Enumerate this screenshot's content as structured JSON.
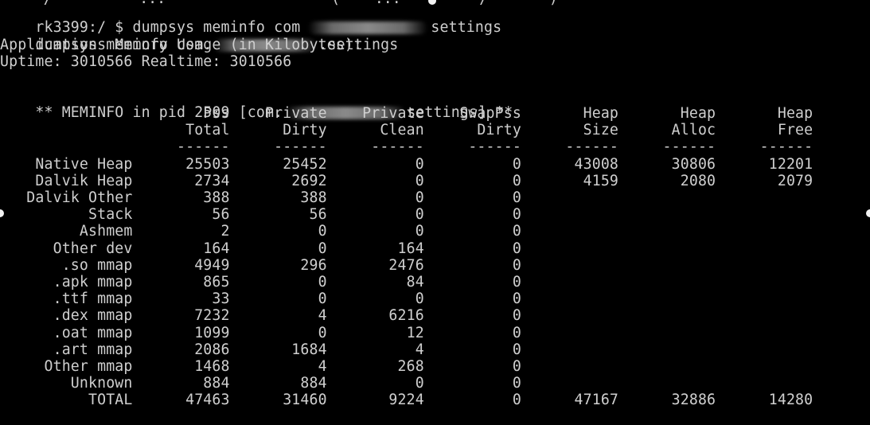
{
  "terminal": {
    "cut_top_line": "     /          ...                   (    ...         /       )",
    "prompt_prefix": "rk3399:/ $ dumpsys meminfo com",
    "prompt_suffix": "settings",
    "echo_prefix": "dumpsys meminfo com.",
    "echo_suffix": ".settings",
    "heading": "Applications Memory Usage (in Kilobytes):",
    "uptime_line": "Uptime: 3010566 Realtime: 3010566",
    "meminfo_prefix": "** MEMINFO in pid 2509 [com.",
    "meminfo_suffix": "settings] **"
  },
  "table": {
    "header_row1": [
      "Pss",
      "Private",
      "Private",
      "SwapPss",
      "Heap",
      "Heap",
      "Heap"
    ],
    "header_row2": [
      "Total",
      "Dirty",
      "Clean",
      "Dirty",
      "Size",
      "Alloc",
      "Free"
    ],
    "rows": [
      {
        "name": "Native Heap",
        "values": [
          "25503",
          "25452",
          "0",
          "0",
          "43008",
          "30806",
          "12201"
        ]
      },
      {
        "name": "Dalvik Heap",
        "values": [
          "2734",
          "2692",
          "0",
          "0",
          "4159",
          "2080",
          "2079"
        ]
      },
      {
        "name": "Dalvik Other",
        "values": [
          "388",
          "388",
          "0",
          "0",
          "",
          "",
          ""
        ]
      },
      {
        "name": "Stack",
        "values": [
          "56",
          "56",
          "0",
          "0",
          "",
          "",
          ""
        ]
      },
      {
        "name": "Ashmem",
        "values": [
          "2",
          "0",
          "0",
          "0",
          "",
          "",
          ""
        ]
      },
      {
        "name": "Other dev",
        "values": [
          "164",
          "0",
          "164",
          "0",
          "",
          "",
          ""
        ]
      },
      {
        "name": ".so mmap",
        "values": [
          "4949",
          "296",
          "2476",
          "0",
          "",
          "",
          ""
        ]
      },
      {
        "name": ".apk mmap",
        "values": [
          "865",
          "0",
          "84",
          "0",
          "",
          "",
          ""
        ]
      },
      {
        "name": ".ttf mmap",
        "values": [
          "33",
          "0",
          "0",
          "0",
          "",
          "",
          ""
        ]
      },
      {
        "name": ".dex mmap",
        "values": [
          "7232",
          "4",
          "6216",
          "0",
          "",
          "",
          ""
        ]
      },
      {
        "name": ".oat mmap",
        "values": [
          "1099",
          "0",
          "12",
          "0",
          "",
          "",
          ""
        ]
      },
      {
        "name": ".art mmap",
        "values": [
          "2086",
          "1684",
          "4",
          "0",
          "",
          "",
          ""
        ]
      },
      {
        "name": "Other mmap",
        "values": [
          "1468",
          "4",
          "268",
          "0",
          "",
          "",
          ""
        ]
      },
      {
        "name": "Unknown",
        "values": [
          "884",
          "884",
          "0",
          "0",
          "",
          "",
          ""
        ]
      },
      {
        "name": "TOTAL",
        "values": [
          "47463",
          "31460",
          "9224",
          "0",
          "47167",
          "32886",
          "14280"
        ]
      }
    ]
  },
  "colors": {
    "background": "#000000",
    "text": "#cfcfcf",
    "redaction": "#7a7a7a",
    "handle": "#f2f2f2"
  }
}
